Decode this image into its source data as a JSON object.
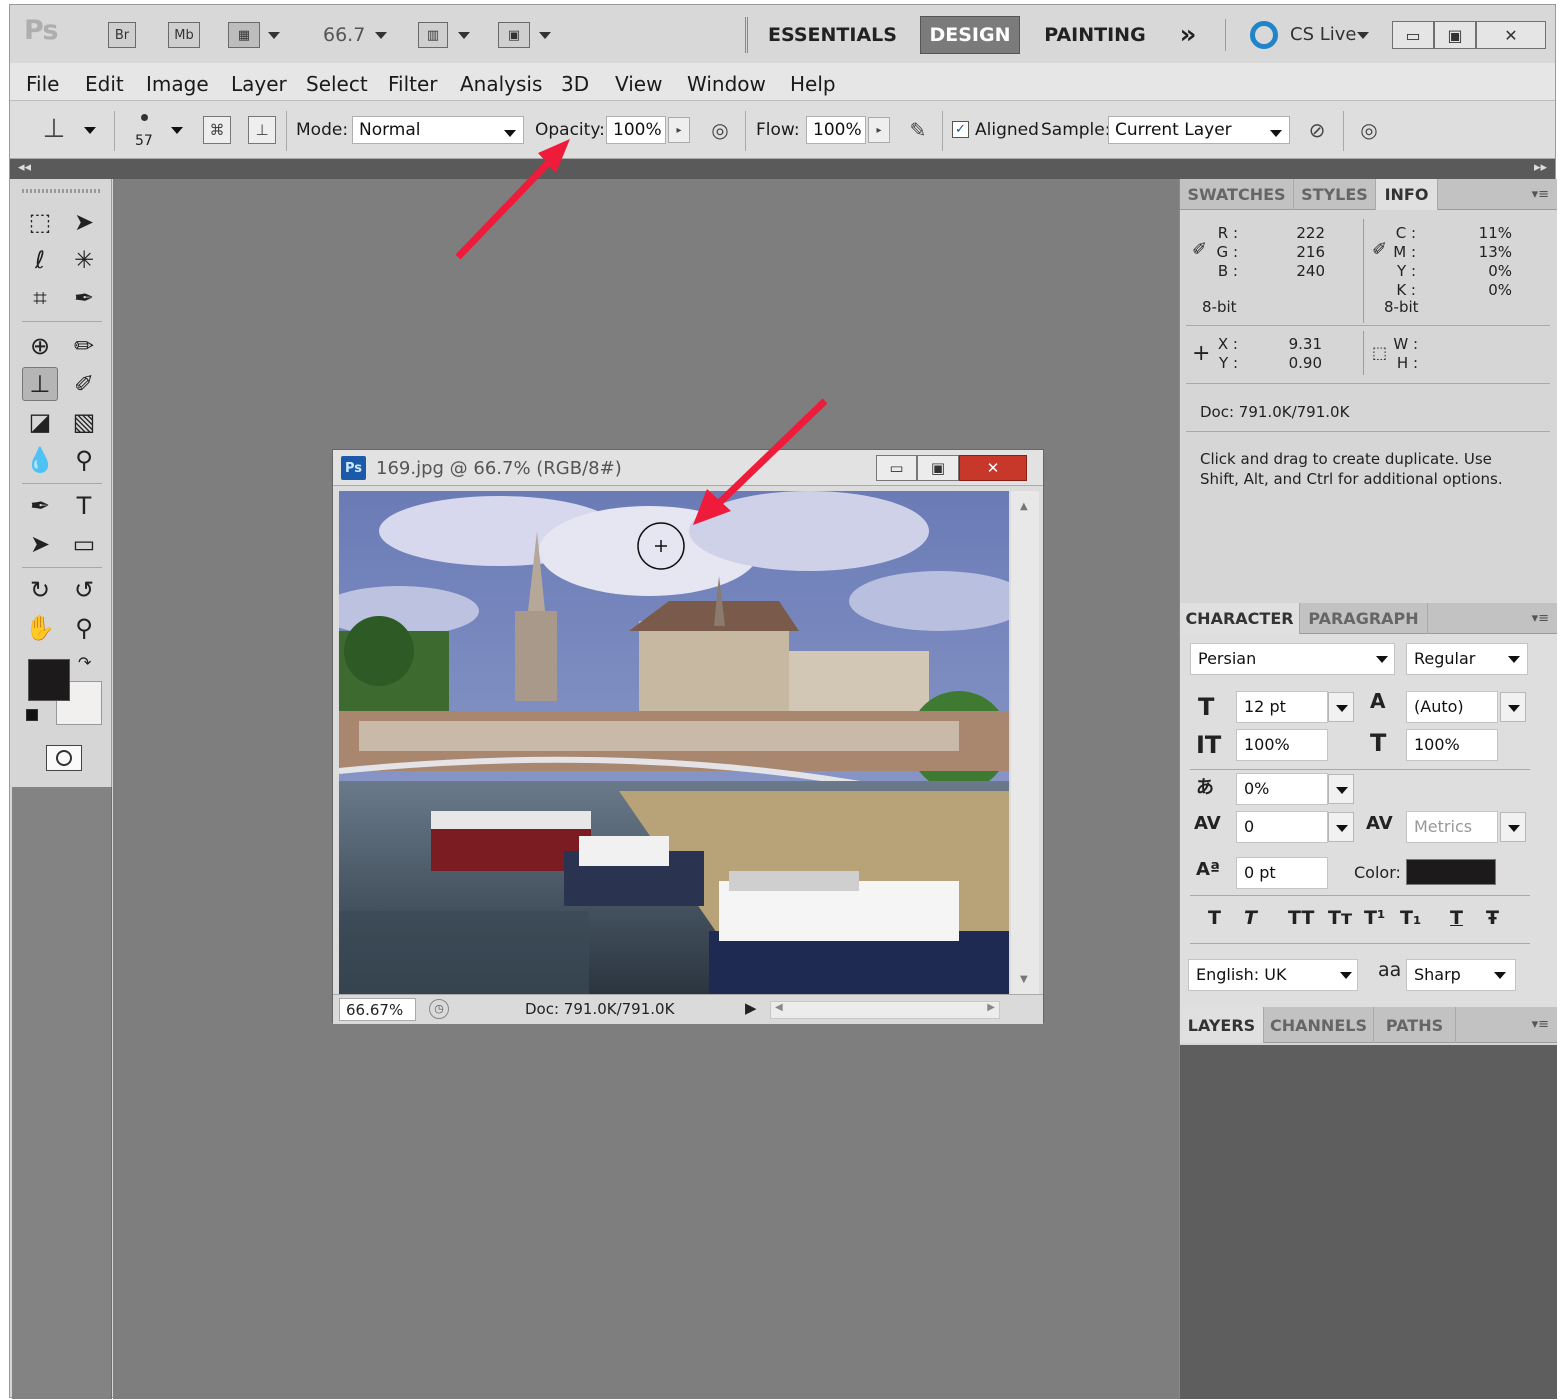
{
  "app": {
    "logo": "Ps",
    "bridge_btn": "Br",
    "minibridge_btn": "Mb",
    "zoom_level": "66.7"
  },
  "workspaces": {
    "essentials": "ESSENTIALS",
    "design": "DESIGN",
    "painting": "PAINTING",
    "more": "»",
    "cs_live": "CS Live"
  },
  "menu": [
    "File",
    "Edit",
    "Image",
    "Layer",
    "Select",
    "Filter",
    "Analysis",
    "3D",
    "View",
    "Window",
    "Help"
  ],
  "options": {
    "brush_size": "57",
    "mode_label": "Mode:",
    "mode_value": "Normal",
    "opacity_label": "Opacity:",
    "opacity_value": "100%",
    "flow_label": "Flow:",
    "flow_value": "100%",
    "aligned_label": "Aligned",
    "sample_label": "Sample:",
    "sample_value": "Current Layer"
  },
  "document": {
    "badge": "Ps",
    "title": "169.jpg @ 66.7% (RGB/8#)",
    "zoom": "66.67%",
    "doc_size": "Doc: 791.0K/791.0K"
  },
  "info_panel": {
    "tabs": [
      "SWATCHES",
      "STYLES",
      "INFO"
    ],
    "rgb_labels": [
      "R :",
      "G :",
      "B :"
    ],
    "rgb_values": [
      "222",
      "216",
      "240"
    ],
    "cmyk_labels": [
      "C :",
      "M :",
      "Y :",
      "K :"
    ],
    "cmyk_values": [
      "11%",
      "13%",
      "0%",
      "0%"
    ],
    "bit_left": "8-bit",
    "bit_right": "8-bit",
    "xy_labels": [
      "X :",
      "Y :"
    ],
    "xy_values": [
      "9.31",
      "0.90"
    ],
    "wh_labels": [
      "W :",
      "H :"
    ],
    "doc_size": "Doc: 791.0K/791.0K",
    "hint": "Click and drag to create duplicate.  Use Shift, Alt, and Ctrl for additional options."
  },
  "character_panel": {
    "tabs": [
      "CHARACTER",
      "PARAGRAPH"
    ],
    "font_family": "Persian",
    "font_style": "Regular",
    "font_size": "12 pt",
    "leading": "(Auto)",
    "vertical_scale": "100%",
    "horizontal_scale": "100%",
    "tsume": "0%",
    "tracking": "0",
    "kerning": "Metrics",
    "baseline": "0 pt",
    "color_label": "Color:",
    "language": "English: UK",
    "antialias_icon": "aa",
    "antialias": "Sharp",
    "style_buttons": [
      "T",
      "T",
      "TT",
      "Tт",
      "T¹",
      "T₁",
      "T",
      "Ŧ"
    ]
  },
  "layers_panel": {
    "tabs": [
      "LAYERS",
      "CHANNELS",
      "PATHS"
    ]
  },
  "colors": {
    "arrow": "#ee1b3a",
    "foreground": "#1d1a1c",
    "background": "#f2efef",
    "char_color": "#1d1a1c"
  }
}
